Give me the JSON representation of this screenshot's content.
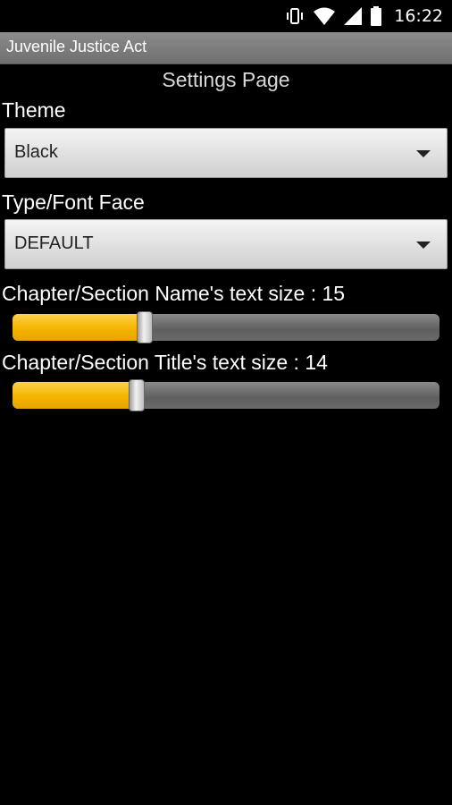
{
  "status_bar": {
    "time": "16:22",
    "icons": [
      "vibrate-icon",
      "wifi-icon",
      "signal-icon",
      "battery-icon"
    ]
  },
  "app": {
    "title": "Juvenile Justice Act"
  },
  "page": {
    "heading": "Settings Page"
  },
  "theme": {
    "label": "Theme",
    "selected": "Black"
  },
  "font_face": {
    "label": "Type/Font Face",
    "selected": "DEFAULT"
  },
  "name_size": {
    "label": "Chapter/Section Name's text size : 15",
    "value": 15,
    "fraction": 0.31
  },
  "title_size": {
    "label": "Chapter/Section Title's text size : 14",
    "value": 14,
    "fraction": 0.29
  },
  "colors": {
    "accent": "#f4b400",
    "background": "#000000",
    "titlebar": "#7d7d7d"
  }
}
